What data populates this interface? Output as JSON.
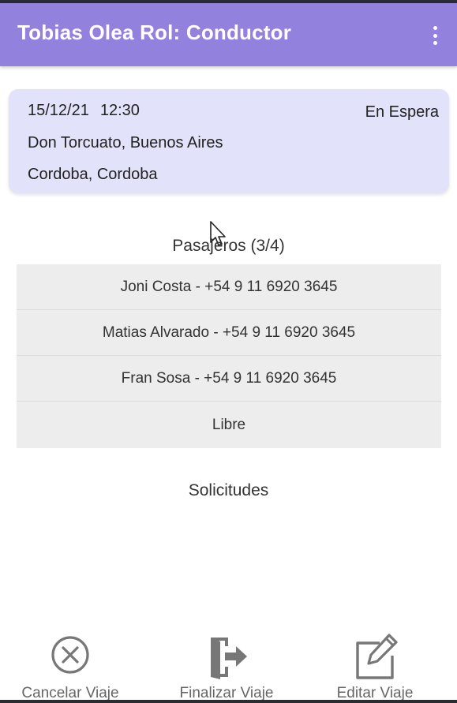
{
  "app_bar": {
    "title": "Tobias Olea Rol: Conductor",
    "menu_icon": "more-vert-icon",
    "background_color": "#9281dd"
  },
  "trip": {
    "date": "15/12/21",
    "time": "12:30",
    "status": "En Espera",
    "origin": "Don Torcuato, Buenos Aires",
    "destination": "Cordoba, Cordoba",
    "card_color": "#e3e2fb"
  },
  "passengers": {
    "title": "Pasajeros (3/4)",
    "items": [
      {
        "label": "Joni Costa - +54 9 11 6920 3645"
      },
      {
        "label": "Matias Alvarado - +54 9 11 6920 3645"
      },
      {
        "label": "Fran Sosa - +54 9 11 6920 3645"
      },
      {
        "label": "Libre"
      }
    ]
  },
  "requests": {
    "title": "Solicitudes"
  },
  "actions": {
    "cancel": {
      "label": "Cancelar Viaje",
      "icon": "cancel-circle-icon"
    },
    "finish": {
      "label": "Finalizar Viaje",
      "icon": "exit-door-icon"
    },
    "edit": {
      "label": "Editar Viaje",
      "icon": "edit-icon"
    }
  }
}
